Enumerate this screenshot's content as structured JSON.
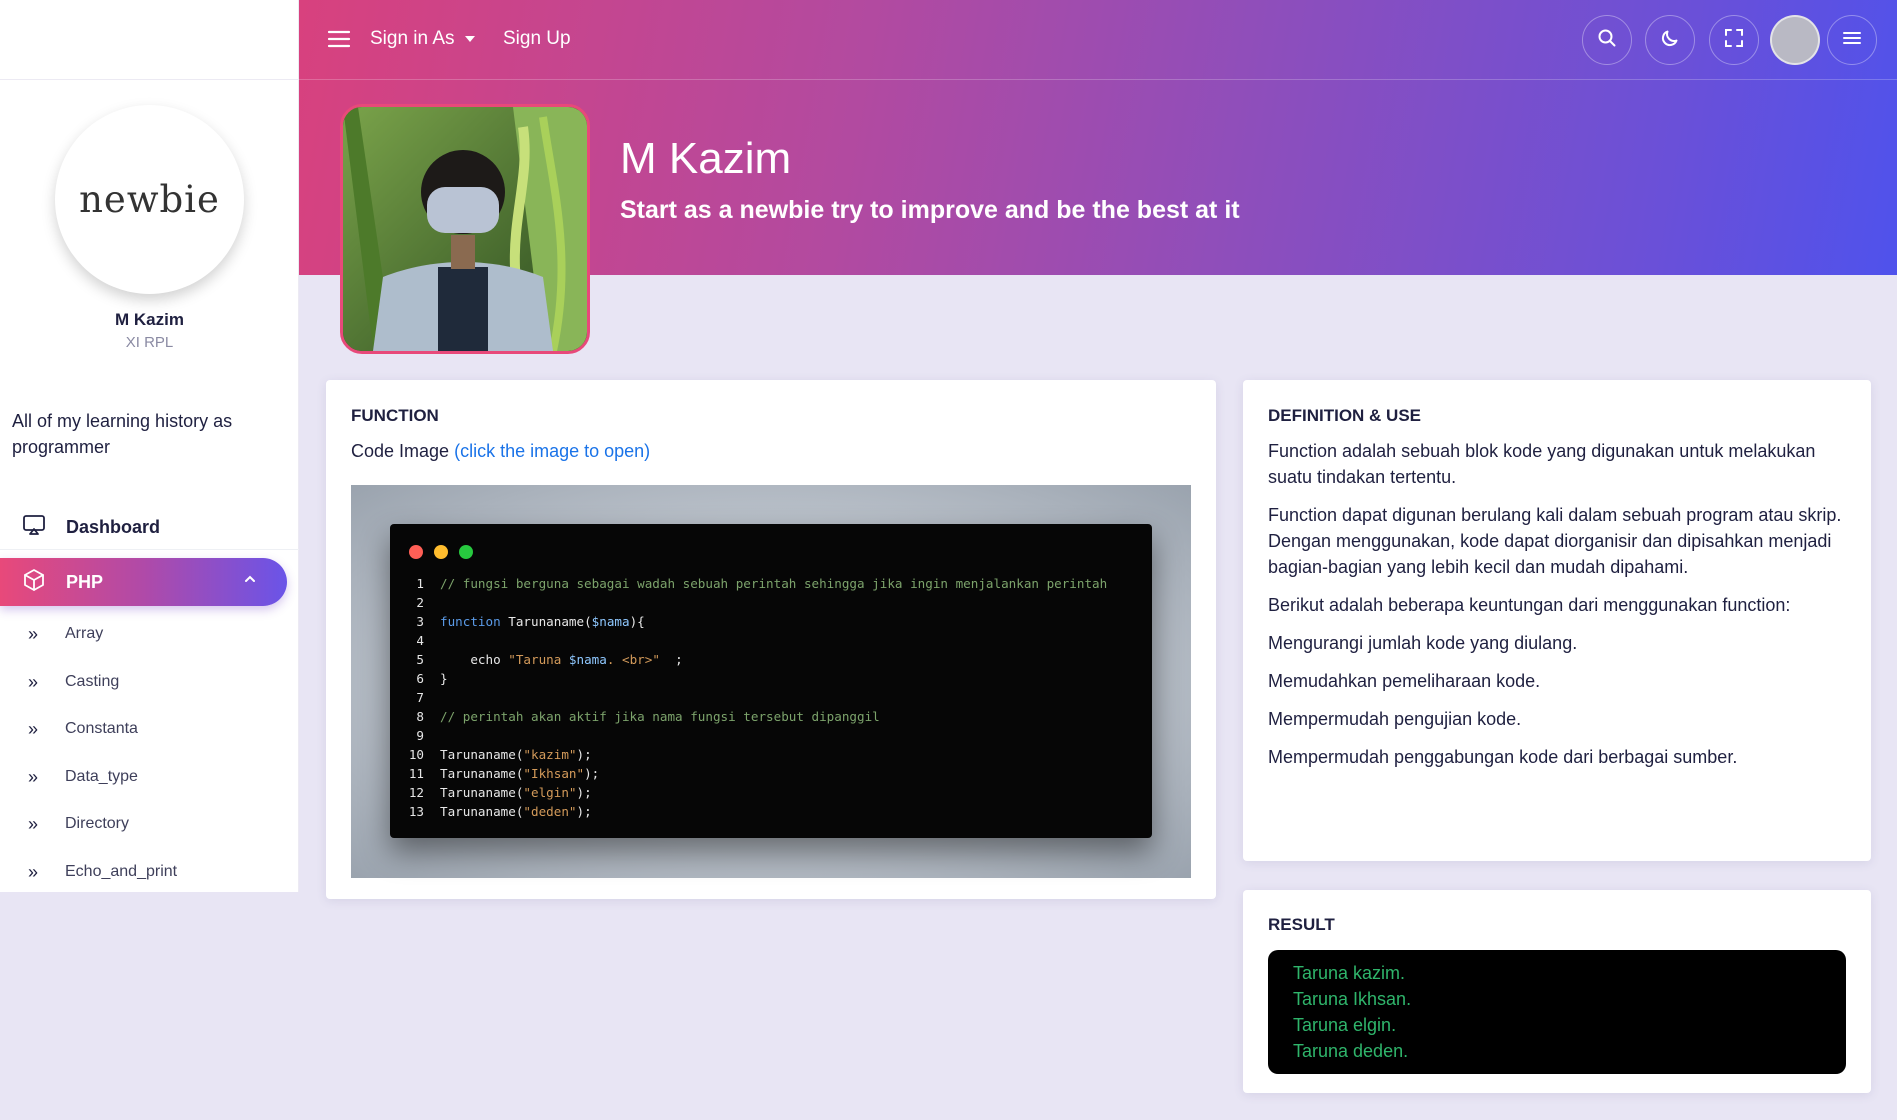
{
  "sidebar": {
    "logo_text": "newbie",
    "user_name": "M Kazim",
    "user_class": "XI RPL",
    "tagline": "All of my learning history as programmer",
    "nav": {
      "dashboard": "Dashboard",
      "php": "PHP"
    },
    "sub_items": [
      "Array",
      "Casting",
      "Constanta",
      "Data_type",
      "Directory",
      "Echo_and_print"
    ],
    "sub_marker": "»"
  },
  "topbar": {
    "sign_in_label": "Sign in As",
    "sign_up_label": "Sign Up"
  },
  "hero": {
    "name": "M Kazim",
    "subtitle": "Start as a newbie try to improve and be the best at it"
  },
  "function_card": {
    "title": "FUNCTION",
    "code_image_label": "Code Image",
    "code_image_link": "(click the image to open)",
    "code_lines": [
      {
        "n": "1",
        "parts": [
          {
            "t": "// fungsi berguna sebagai wadah sebuah perintah sehingga jika ingin menjalankan perintah",
            "c": "comment"
          }
        ]
      },
      {
        "n": "2",
        "parts": []
      },
      {
        "n": "3",
        "parts": [
          {
            "t": "function",
            "c": "kw"
          },
          {
            "t": " Tarunaname(",
            "c": "plain"
          },
          {
            "t": "$nama",
            "c": "var"
          },
          {
            "t": "){",
            "c": "plain"
          }
        ]
      },
      {
        "n": "4",
        "parts": []
      },
      {
        "n": "5",
        "parts": [
          {
            "t": "    echo ",
            "c": "plain"
          },
          {
            "t": "\"Taruna ",
            "c": "str"
          },
          {
            "t": "$nama",
            "c": "var"
          },
          {
            "t": ". <br>\"",
            "c": "str"
          },
          {
            "t": "  ;",
            "c": "plain"
          }
        ]
      },
      {
        "n": "6",
        "parts": [
          {
            "t": "}",
            "c": "plain"
          }
        ]
      },
      {
        "n": "7",
        "parts": []
      },
      {
        "n": "8",
        "parts": [
          {
            "t": "// perintah akan aktif jika nama fungsi tersebut dipanggil",
            "c": "comment"
          }
        ]
      },
      {
        "n": "9",
        "parts": []
      },
      {
        "n": "10",
        "parts": [
          {
            "t": "Tarunaname(",
            "c": "plain"
          },
          {
            "t": "\"kazim\"",
            "c": "str"
          },
          {
            "t": ");",
            "c": "plain"
          }
        ]
      },
      {
        "n": "11",
        "parts": [
          {
            "t": "Tarunaname(",
            "c": "plain"
          },
          {
            "t": "\"Ikhsan\"",
            "c": "str"
          },
          {
            "t": ");",
            "c": "plain"
          }
        ]
      },
      {
        "n": "12",
        "parts": [
          {
            "t": "Tarunaname(",
            "c": "plain"
          },
          {
            "t": "\"elgin\"",
            "c": "str"
          },
          {
            "t": ");",
            "c": "plain"
          }
        ]
      },
      {
        "n": "13",
        "parts": [
          {
            "t": "Tarunaname(",
            "c": "plain"
          },
          {
            "t": "\"deden\"",
            "c": "str"
          },
          {
            "t": ");",
            "c": "plain"
          }
        ]
      }
    ]
  },
  "definition_card": {
    "title": "DEFINITION & USE",
    "paragraphs": [
      "Function adalah sebuah blok kode yang digunakan untuk melakukan suatu tindakan tertentu.",
      "Function dapat digunan berulang kali dalam sebuah program atau skrip. Dengan menggunakan, kode dapat diorganisir dan dipisahkan menjadi bagian-bagian yang lebih kecil dan mudah dipahami.",
      "Berikut adalah beberapa keuntungan dari menggunakan function:",
      "Mengurangi jumlah kode yang diulang.",
      "Memudahkan pemeliharaan kode.",
      "Mempermudah pengujian kode.",
      "Mempermudah penggabungan kode dari berbagai sumber."
    ]
  },
  "result_card": {
    "title": "RESULT",
    "lines": [
      "Taruna kazim.",
      "Taruna Ikhsan.",
      "Taruna elgin.",
      "Taruna deden."
    ]
  },
  "icons": {
    "hamburger": "hamburger-icon",
    "search": "search-icon",
    "theme": "moon-icon",
    "fullscreen": "fullscreen-icon",
    "menu": "menu-icon",
    "dashboard": "monitor-icon",
    "php": "cube-icon",
    "chevron": "chevron-up-icon"
  },
  "colors": {
    "gradient_start": "#d8417e",
    "gradient_end": "#4f52ec",
    "link": "#1a73e8",
    "result_text": "#2fb56b",
    "background": "#e8e5f4"
  }
}
